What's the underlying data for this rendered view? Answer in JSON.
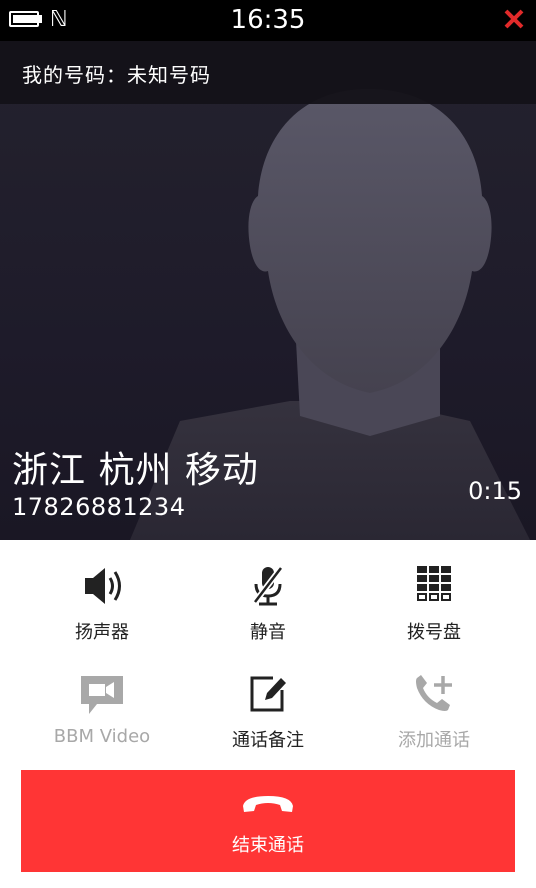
{
  "status_bar": {
    "time": "16:35",
    "battery_icon": "battery-icon",
    "nfc_icon": "nfc-icon",
    "close_icon": "close-icon"
  },
  "call": {
    "my_number_label": "我的号码：未知号码",
    "caller_name": "浙江 杭州 移动",
    "caller_number": "17826881234",
    "duration": "0:15"
  },
  "controls": [
    {
      "label": "扬声器",
      "icon": "speaker-icon",
      "enabled": true
    },
    {
      "label": "静音",
      "icon": "mute-microphone-icon",
      "enabled": true
    },
    {
      "label": "拨号盘",
      "icon": "dialpad-icon",
      "enabled": true
    },
    {
      "label": "BBM Video",
      "icon": "video-chat-icon",
      "enabled": false
    },
    {
      "label": "通话备注",
      "icon": "edit-note-icon",
      "enabled": true
    },
    {
      "label": "添加通话",
      "icon": "add-call-icon",
      "enabled": false
    }
  ],
  "end_call": {
    "label": "结束通话",
    "icon": "hang-up-icon"
  },
  "colors": {
    "end_call_bg": "#ff3535",
    "close_x": "#e12a2a",
    "disabled_text": "#a8a8a8",
    "caller_bg": "#1e1b2a"
  }
}
